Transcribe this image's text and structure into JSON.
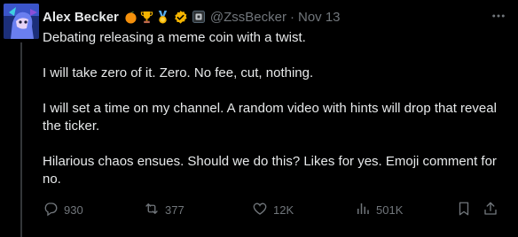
{
  "tweet": {
    "author_name": "Alex Becker",
    "handle": "@ZssBecker",
    "date": "Nov 13",
    "separator": "·",
    "paragraphs": [
      "Debating releasing a meme coin with a twist.",
      "I will take zero of it. Zero. No fee, cut, nothing.",
      "I will set a time on my channel. A random video with hints will drop that reveal the ticker.",
      "Hilarious chaos ensues. Should we do this? Likes for yes. Emoji comment for no."
    ]
  },
  "badges": {
    "emojis": [
      "orange-fruit",
      "trophy",
      "medal"
    ],
    "verified_color": "#f4b400",
    "affiliate": "affiliate-badge"
  },
  "actions": {
    "replies": "930",
    "reposts": "377",
    "likes": "12K",
    "views": "501K"
  },
  "colors": {
    "background": "#000000",
    "text": "#e7e9ea",
    "muted": "#71767b"
  }
}
